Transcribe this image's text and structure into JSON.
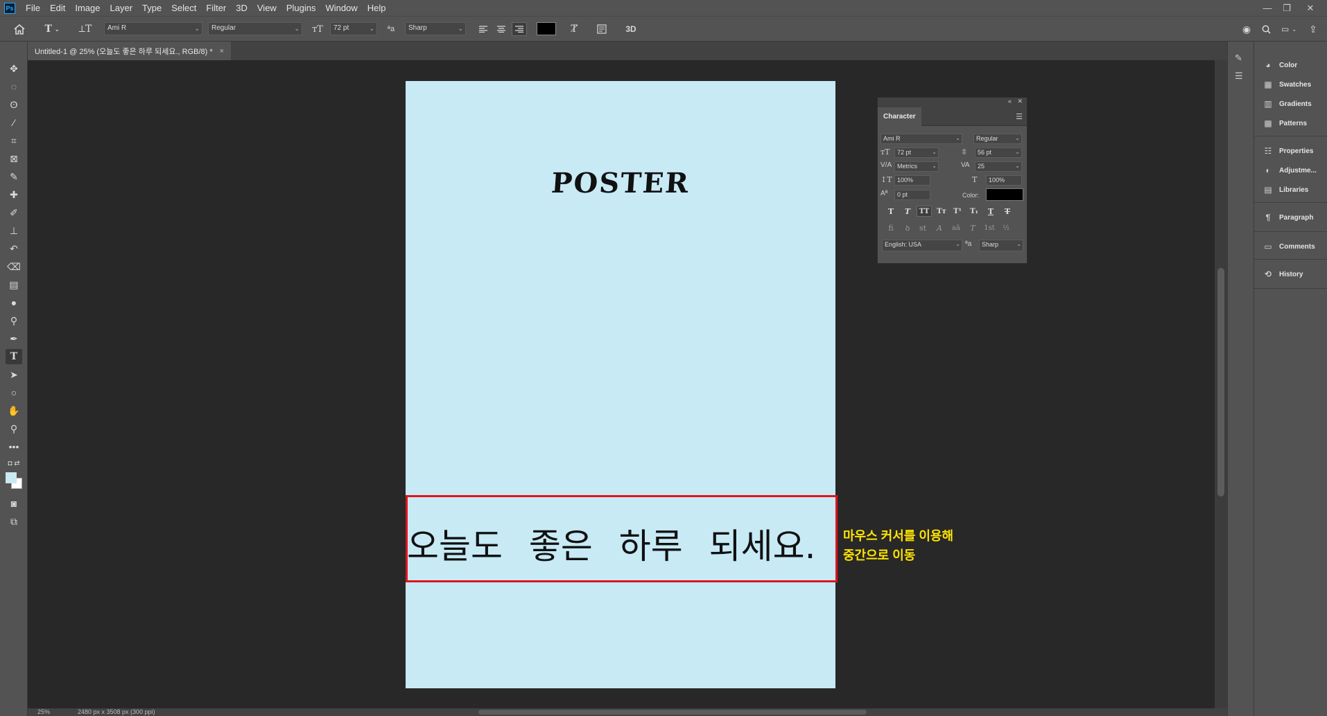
{
  "app": {
    "logo": "Ps"
  },
  "menu": [
    "File",
    "Edit",
    "Image",
    "Layer",
    "Type",
    "Select",
    "Filter",
    "3D",
    "View",
    "Plugins",
    "Window",
    "Help"
  ],
  "window_controls": {
    "minimize": "—",
    "restore": "❐",
    "close": "✕"
  },
  "options_bar": {
    "font_family": "Ami R",
    "font_style": "Regular",
    "font_size": "72 pt",
    "antialias": "Sharp",
    "aa_icon": "ªa",
    "mode_3d": "3D",
    "text_color": "#000000"
  },
  "document": {
    "tab_title": "Untitled-1 @ 25% (오늘도 좋은 하루 되세요., RGB/8) *",
    "close": "×",
    "canvas_color": "#c7eaf5",
    "poster_title": "POSTER",
    "korean_text": "오늘도 좋은 하루 되세요."
  },
  "annotation": {
    "line1": "마우스 커서를 이용해",
    "line2": "중간으로 이동",
    "color": "#ffe400",
    "box_color": "#e0141c"
  },
  "status": {
    "zoom": "25%",
    "doc_info": "2480 px x 3508 px (300 ppi)"
  },
  "right_panels": [
    "Color",
    "Swatches",
    "Gradients",
    "Patterns",
    "Properties",
    "Adjustme...",
    "Libraries",
    "Paragraph",
    "Comments",
    "History"
  ],
  "character_panel": {
    "tab": "Character",
    "font_family": "Ami R",
    "font_style": "Regular",
    "size": "72 pt",
    "leading": "56 pt",
    "kerning": "Metrics",
    "tracking": "25",
    "vertical_scale": "100%",
    "horizontal_scale": "100%",
    "baseline_shift": "0 pt",
    "color_label": "Color:",
    "color": "#000000",
    "language": "English: USA",
    "antialias": "Sharp",
    "aa_icon": "ªa"
  }
}
